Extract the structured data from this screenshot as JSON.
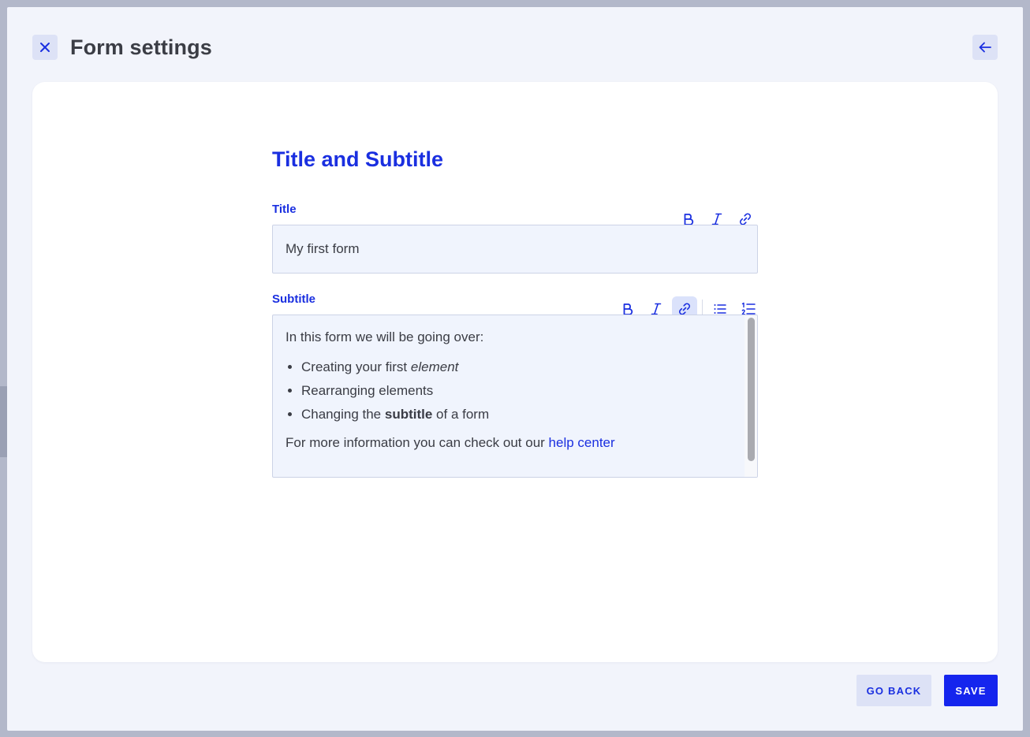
{
  "modal": {
    "title": "Form settings",
    "close_icon": "close-icon",
    "back_icon": "arrow-left-icon"
  },
  "section": {
    "heading": "Title and Subtitle"
  },
  "title_field": {
    "label": "Title",
    "value": "My first form",
    "toolbar": [
      "bold-icon",
      "italic-icon",
      "link-icon"
    ]
  },
  "subtitle_field": {
    "label": "Subtitle",
    "toolbar": [
      "bold-icon",
      "italic-icon",
      "link-icon",
      "bulleted-list-icon",
      "numbered-list-icon"
    ],
    "active_tool": "link-icon",
    "intro": "In this form we will be going over:",
    "list": [
      {
        "prefix": "Creating your first ",
        "emphasis": "element",
        "suffix": ""
      },
      {
        "prefix": "Rearranging elements",
        "emphasis": "",
        "suffix": ""
      },
      {
        "prefix": "Changing the ",
        "strong": "subtitle",
        "suffix": " of a form"
      }
    ],
    "outro": "For more information you can check out our ",
    "link_text": "help center"
  },
  "footer": {
    "go_back_label": "GO BACK",
    "save_label": "SAVE"
  },
  "colors": {
    "accent": "#1a2fe0",
    "primary_button": "#1525ee",
    "secondary_button": "#dde2f6",
    "field_background": "#f0f4fd"
  }
}
